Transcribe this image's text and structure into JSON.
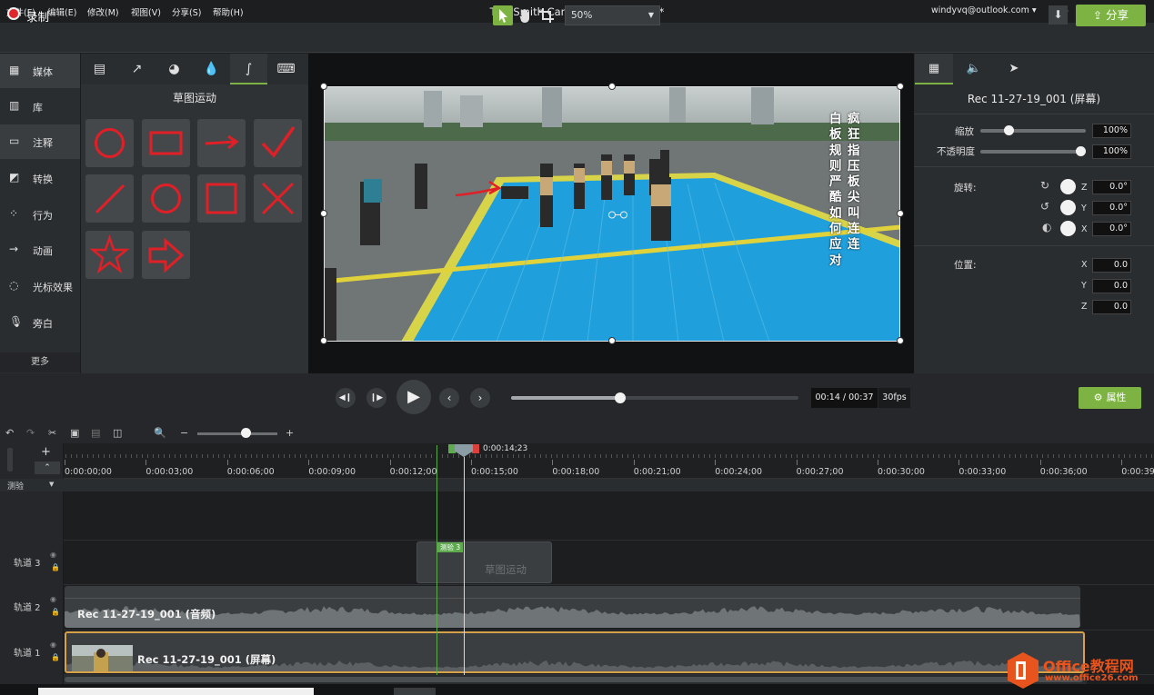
{
  "menubar": {
    "items": [
      "文件(F)",
      "编辑(E)",
      "修改(M)",
      "视图(V)",
      "分享(S)",
      "帮助(H)"
    ],
    "title": "TechSmith Camtasia - 无标题项目*",
    "account": "windyvq@outlook.com ▾",
    "minimize": "—",
    "restore": "❐",
    "close": "✕"
  },
  "toolbar": {
    "record_label": "录制",
    "zoom_value": "50%",
    "share_label": "分享"
  },
  "sidebar": {
    "items": [
      {
        "label": "媒体",
        "icon": "film-icon"
      },
      {
        "label": "库",
        "icon": "library-icon"
      },
      {
        "label": "注释",
        "icon": "annotation-icon"
      },
      {
        "label": "转换",
        "icon": "transition-icon"
      },
      {
        "label": "行为",
        "icon": "behavior-icon"
      },
      {
        "label": "动画",
        "icon": "animation-icon"
      },
      {
        "label": "光标效果",
        "icon": "cursor-effect-icon"
      },
      {
        "label": "旁白",
        "icon": "microphone-icon"
      }
    ],
    "more": "更多"
  },
  "annotations": {
    "title": "草图运动",
    "tabs": [
      "callout-icon",
      "arrow-icon",
      "shape-icon",
      "blur-icon",
      "sketch-motion-icon",
      "keyboard-icon"
    ],
    "shapes": [
      "sketch-circle",
      "sketch-rectangle",
      "sketch-arrow",
      "sketch-checkmark",
      "sketch-line",
      "sketch-ellipse",
      "sketch-square",
      "sketch-x",
      "sketch-star",
      "sketch-block-arrow"
    ],
    "shape_color": "#e01f26"
  },
  "preview": {
    "caption_col1": "疯狂指压板尖叫连连",
    "caption_col2": "白板规则严酷如何应对"
  },
  "properties": {
    "tabs": [
      "visual-properties-icon",
      "audio-icon",
      "cursor-icon"
    ],
    "clip_name": "Rec 11-27-19_001 (屏幕)",
    "scale_label": "缩放",
    "scale_value": "100%",
    "opacity_label": "不透明度",
    "opacity_value": "100%",
    "rotation_label": "旋转:",
    "rot_z": "0.0°",
    "rot_y": "0.0°",
    "rot_x": "0.0°",
    "position_label": "位置:",
    "pos_x": "0.0",
    "pos_y": "0.0",
    "pos_z": "0.0",
    "axis_x": "X",
    "axis_y": "Y",
    "axis_z": "Z",
    "scale_level": 0.25,
    "opacity_level": 1.0
  },
  "playback": {
    "time": "00:14 / 00:37",
    "fps": "30fps",
    "properties_label": "属性",
    "progress": 0.38
  },
  "timeline": {
    "playhead_time": "0:00:14;23",
    "ticks": [
      "0:00:00;00",
      "0:00:03;00",
      "0:00:06;00",
      "0:00:09;00",
      "0:00:12;00",
      "0:00:15;00",
      "0:00:18;00",
      "0:00:21;00",
      "0:00:24;00",
      "0:00:27;00",
      "0:00:30;00",
      "0:00:33;00",
      "0:00:36;00",
      "0:00:39;"
    ],
    "marker_label": "测验",
    "tracks": [
      "轨道 3",
      "轨道 2",
      "轨道 1"
    ],
    "sketch_clip": "草图运动",
    "sketch_badge": "测验 3",
    "audio_clip": "Rec 11-27-19_001 (音频)",
    "screen_clip": "Rec 11-27-19_001 (屏幕)"
  },
  "watermark": {
    "brand": "Office教程网",
    "url": "www.office26.com"
  }
}
